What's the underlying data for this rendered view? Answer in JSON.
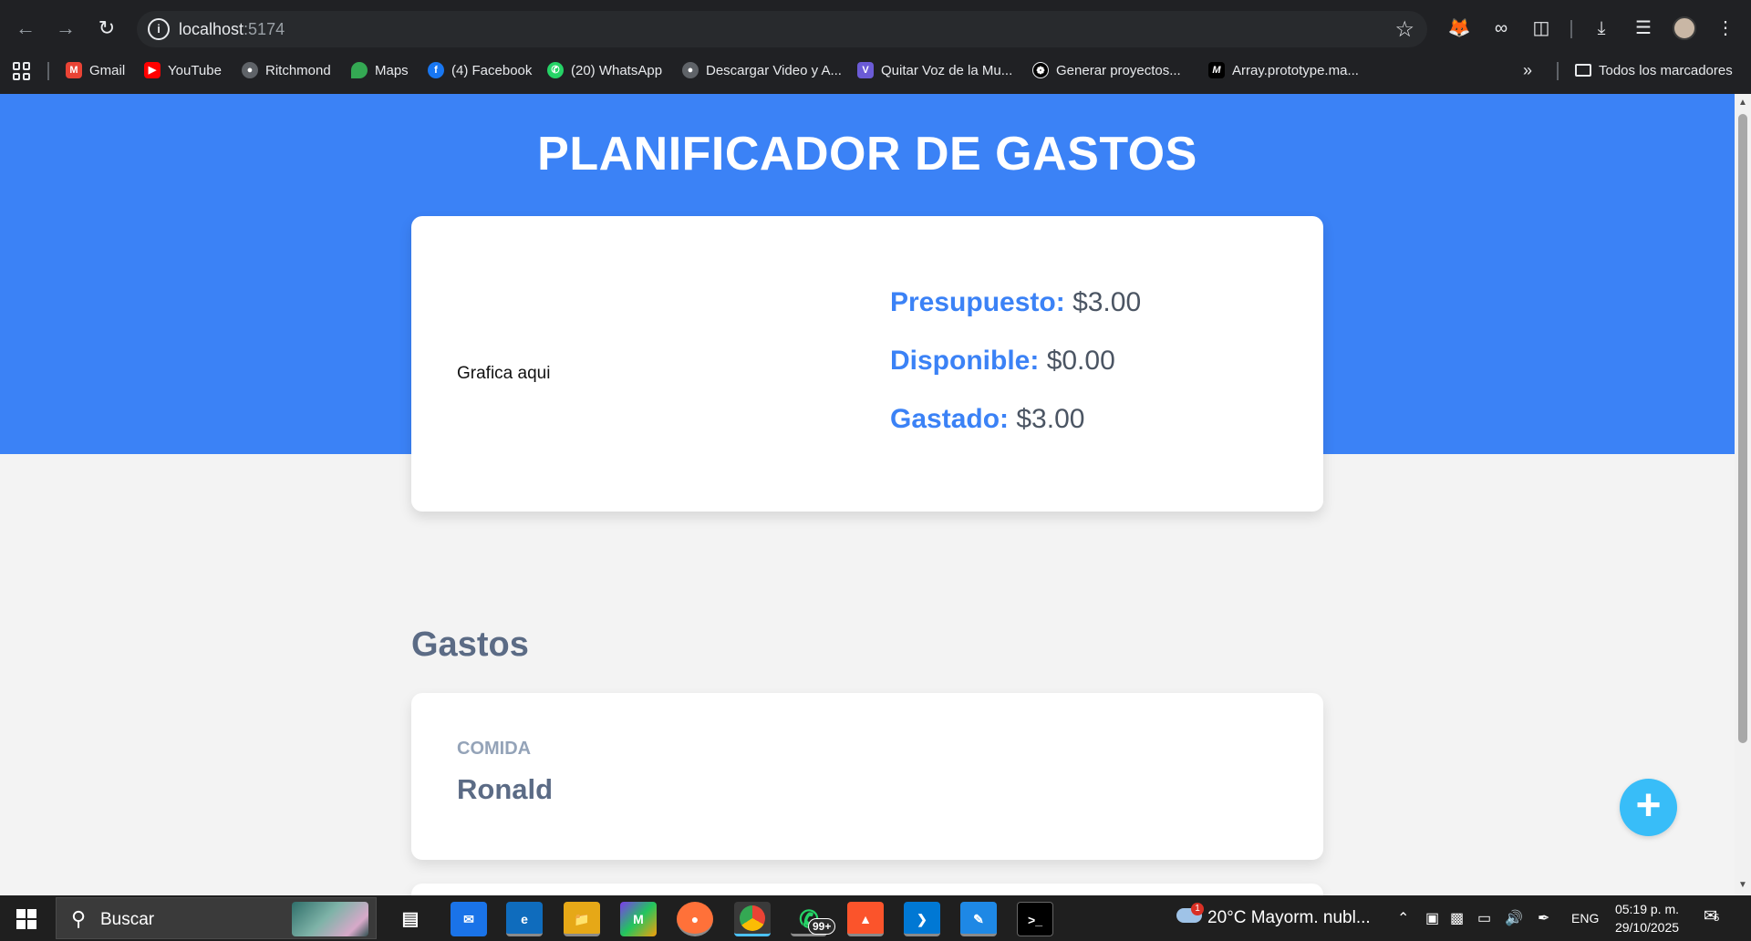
{
  "browser": {
    "url_host": "localhost",
    "url_port": ":5174",
    "bookmarks": [
      {
        "label": "Gmail",
        "icon": "gmail-icon",
        "color": "#ea4335"
      },
      {
        "label": "YouTube",
        "icon": "youtube-icon",
        "color": "#ff0000"
      },
      {
        "label": "Ritchmond",
        "icon": "globe-icon",
        "color": "#5f6368"
      },
      {
        "label": "Maps",
        "icon": "maps-icon",
        "color": "#34a853"
      },
      {
        "label": "(4) Facebook",
        "icon": "facebook-icon",
        "color": "#1877f2"
      },
      {
        "label": "(20) WhatsApp",
        "icon": "whatsapp-icon",
        "color": "#25d366"
      },
      {
        "label": "Descargar Video y A...",
        "icon": "globe-icon",
        "color": "#5f6368"
      },
      {
        "label": "Quitar Voz de la Mu...",
        "icon": "vocal-remover-icon",
        "color": "#6b5bd6"
      },
      {
        "label": "Generar proyectos...",
        "icon": "openai-icon",
        "color": "#000000"
      },
      {
        "label": "Array.prototype.ma...",
        "icon": "mdn-icon",
        "color": "#000000"
      }
    ],
    "all_bookmarks_label": "Todos los marcadores"
  },
  "app": {
    "title": "PLANIFICADOR DE GASTOS",
    "chart_placeholder": "Grafica aqui",
    "budget": {
      "presupuesto_label": "Presupuesto:",
      "presupuesto_value": "$3.00",
      "disponible_label": "Disponible:",
      "disponible_value": "$0.00",
      "gastado_label": "Gastado:",
      "gastado_value": "$3.00"
    },
    "expenses_title": "Gastos",
    "expenses": [
      {
        "category": "COMIDA",
        "name": "Ronald"
      }
    ],
    "fab_label": "+",
    "colors": {
      "primary": "#3b82f6",
      "fab": "#38bdf8",
      "text_muted": "#5b6b85"
    }
  },
  "taskbar": {
    "search_placeholder": "Buscar",
    "whatsapp_badge": "99+",
    "weather": "20°C  Mayorm. nubl...",
    "weather_alert": "1",
    "language": "ENG",
    "time": "05:19 p. m.",
    "date": "29/10/2025",
    "notifications": "5"
  }
}
